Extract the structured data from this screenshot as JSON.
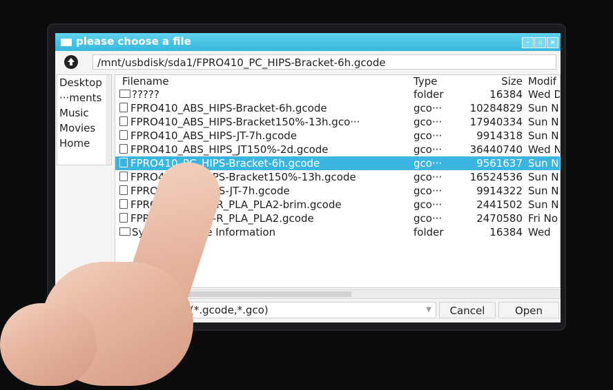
{
  "window": {
    "title": "please choose a file",
    "controls": [
      "–",
      "▫",
      "×"
    ]
  },
  "path": {
    "value": "/mnt/usbdisk/sda1/FPRO410_PC_HIPS-Bracket-6h.gcode"
  },
  "sidebar": {
    "items": [
      {
        "label": "Desktop"
      },
      {
        "label": "···ments"
      },
      {
        "label": "Music"
      },
      {
        "label": "Movies"
      },
      {
        "label": "Home"
      }
    ]
  },
  "files": {
    "columns": {
      "name": "Filename",
      "type": "Type",
      "size": "Size",
      "modified": "Modif"
    },
    "rows": [
      {
        "name": "?????",
        "type": "folder",
        "size": "16384",
        "modified": "Wed D",
        "icon": "folder-icon"
      },
      {
        "name": "FPRO410_ABS_HIPS-Bracket-6h.gcode",
        "type": "gco···",
        "size": "10284829",
        "modified": "Sun N",
        "icon": "file-icon"
      },
      {
        "name": "FPRO410_ABS_HIPS-Bracket150%-13h.gco···",
        "type": "gco···",
        "size": "17940334",
        "modified": "Sun N",
        "icon": "file-icon"
      },
      {
        "name": "FPRO410_ABS_HIPS-JT-7h.gcode",
        "type": "gco···",
        "size": "9914318",
        "modified": "Sun N",
        "icon": "file-icon"
      },
      {
        "name": "FPRO410_ABS_HIPS_JT150%-2d.gcode",
        "type": "gco···",
        "size": "36440740",
        "modified": "Wed N",
        "icon": "file-icon"
      },
      {
        "name": "FPRO410_PC_HIPS-Bracket-6h.gcode",
        "type": "gco···",
        "size": "9561637",
        "modified": "Sun N",
        "icon": "file-icon"
      },
      {
        "name": "FPRO410_PC_HIPS-Bracket150%-13h.gcode",
        "type": "gco···",
        "size": "16524536",
        "modified": "Sun N",
        "icon": "file-icon"
      },
      {
        "name": "FPRO410_PC_HIPS-JT-7h.gcode",
        "type": "gco···",
        "size": "9914322",
        "modified": "Sun N",
        "icon": "file-icon"
      },
      {
        "name": "FPRO410_cali_1-R_PLA_PLA2-brim.gcode",
        "type": "gco···",
        "size": "2441502",
        "modified": "Sun N",
        "icon": "file-icon"
      },
      {
        "name": "FPRO410_cali_1-R_PLA_PLA2.gcode",
        "type": "gco···",
        "size": "2470580",
        "modified": "Fri No",
        "icon": "file-icon"
      },
      {
        "name": "System Volume Information",
        "type": "folder",
        "size": "16384",
        "modified": "Wed",
        "icon": "folder-icon"
      }
    ],
    "selected_index": 5
  },
  "filter": {
    "value": "Gcode files (*.gcode,*.gco)"
  },
  "buttons": {
    "cancel": "Cancel",
    "open": "Open"
  },
  "colors": {
    "titlebar": "#38b8dc",
    "selection": "#3ab5e0"
  }
}
